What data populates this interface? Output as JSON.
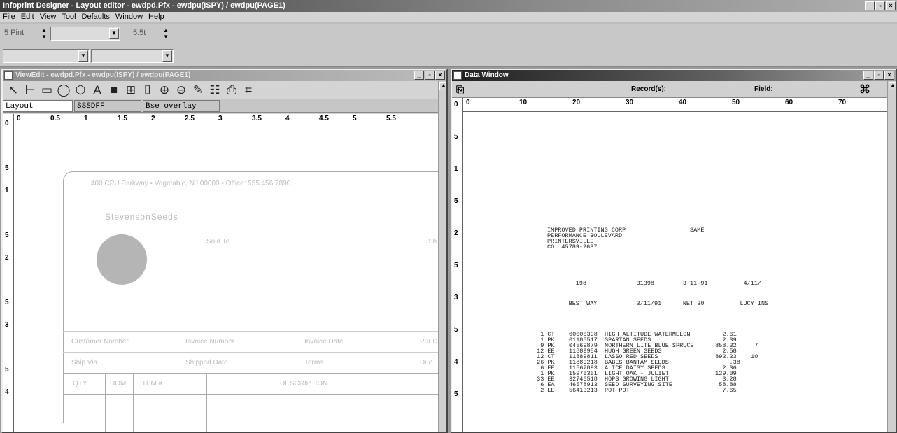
{
  "app": {
    "title": "Infoprint Designer - Layout editor - ewdpd.Pfx - ewdpu(ISPY) / ewdpu(PAGE1)",
    "controls": {
      "minimize": "_",
      "maximize": "▫",
      "close": "×"
    }
  },
  "menu": [
    "File",
    "Edit",
    "View",
    "Tool",
    "Defaults",
    "Window",
    "Help"
  ],
  "toolbar": {
    "field1_label": "5 Pint",
    "field2_label": "5.5t",
    "combo1_value": "",
    "combo2_value": "",
    "combo3_value": ""
  },
  "layout_window": {
    "title": "ViewEdit - ewdpd.Pfx - ewdpu(ISPY) / ewdpu(PAGE1)",
    "tools": [
      "select-arrow-icon",
      "line-icon",
      "rectangle-icon",
      "ellipse-icon",
      "polygon-icon",
      "text-icon",
      "fill-box-icon",
      "grid-icon",
      "box-icon",
      "zoom-in-icon",
      "zoom-out-icon",
      "paint-icon",
      "field-icon",
      "object-icon",
      "ruler-icon"
    ],
    "layer_fields": [
      "Layout",
      "SSSDFF",
      "Bse overlay"
    ],
    "ruler_h": [
      "0",
      "0.5",
      "1",
      "1.5",
      "2",
      "2.5",
      "3",
      "3.5",
      "4",
      "4.5",
      "5",
      "5.5"
    ],
    "ruler_v": [
      "0",
      "",
      "5",
      "1",
      "",
      "5",
      "2",
      "",
      "5",
      "3",
      "",
      "5",
      "4"
    ],
    "form": {
      "header_text": "400 CPU Parkway  •  Vegetable, NJ 00000  •  Office: 555.456.7890",
      "logo_text": "StevensonSeeds",
      "logo_sub": "Sold To",
      "side_label": "Sh",
      "row1": [
        "Customer Number",
        "Invoice Number",
        "Invoice Date",
        "Pur Date"
      ],
      "row2": [
        "Ship Via",
        "Shipped Date",
        "Terms",
        "Due"
      ],
      "columns": [
        "QTY",
        "UOM",
        "ITEM #",
        "DESCRIPTION"
      ]
    }
  },
  "data_window": {
    "title": "Data Window",
    "record_label": "Record(s):",
    "field_label": "Field:",
    "ruler_h": [
      "0",
      "10",
      "20",
      "30",
      "40",
      "50",
      "60",
      "70"
    ],
    "ruler_v": [
      "0",
      "5",
      "1",
      "5",
      "2",
      "5",
      "3",
      "5",
      "4",
      "5"
    ],
    "address": [
      "IMPROVED PRINTING CORP                  SAME",
      "PERFORMANCE BOULEVARD",
      "PRINTERSVILLE",
      "CO  45789-2637"
    ],
    "line1": "        198              31398        3-11-91          4/11/",
    "line2": "      BEST WAY           3/11/91      NET 30          LUCY INS",
    "items": [
      "  1 CT    00000398  HIGH ALTITUDE WATERMELON         2.61",
      "  1 PK    01188517  SPARTAN SEEDS                    2.39",
      "  9 PK    04569879  NORTHERN LITE BLUE SPRUCE      858.32     7",
      " 12 EE    11889984  HUGH GREEN SEEDS                 2.58",
      " 12 CT    11889811  LASSO RED SEEDS                892.23    10",
      " 26 PK    11889218  BABES BANTAM SEEDS                 .38",
      "  6 EE    11567893  ALICE DAISY SEEDS                2.36",
      "  1 PK    15976361  LIGHT OAK - JULIET             129.09",
      " 33 EE    32746518  HOPS GROWING LIGHT               3.28",
      "  6 EA    46578913  SEED SURVEYING SITE             58.88",
      "  2 EE    56413213  POT POT                          7.65"
    ]
  }
}
